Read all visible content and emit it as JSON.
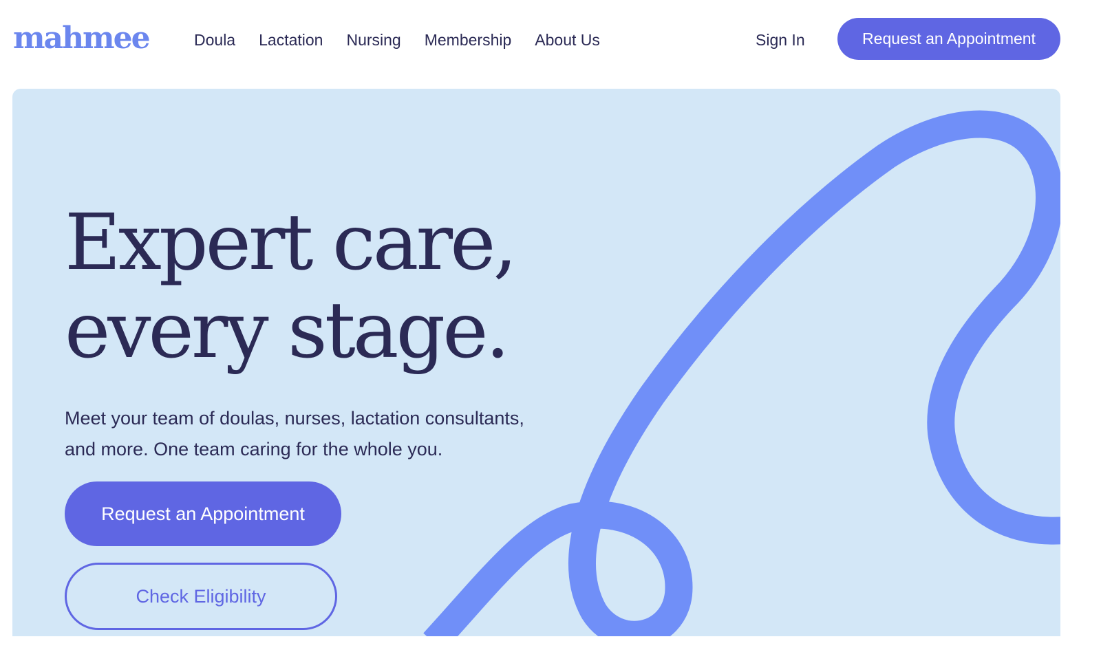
{
  "header": {
    "logo": "mahmee",
    "nav": [
      "Doula",
      "Lactation",
      "Nursing",
      "Membership",
      "About Us"
    ],
    "sign_in": "Sign In",
    "cta": "Request an Appointment"
  },
  "hero": {
    "headline_line1": "Expert care,",
    "headline_line2": "every stage.",
    "subtext_line1": "Meet your team of doulas, nurses, lactation consultants,",
    "subtext_line2": "and more. One team caring for the whole you.",
    "primary_cta": "Request an Appointment",
    "secondary_cta": "Check Eligibility"
  },
  "colors": {
    "brand": "#6b86ee",
    "accent": "#5f66e3",
    "text": "#2b2a55",
    "hero_bg": "#d3e7f7",
    "ribbon": "#708ff8"
  }
}
